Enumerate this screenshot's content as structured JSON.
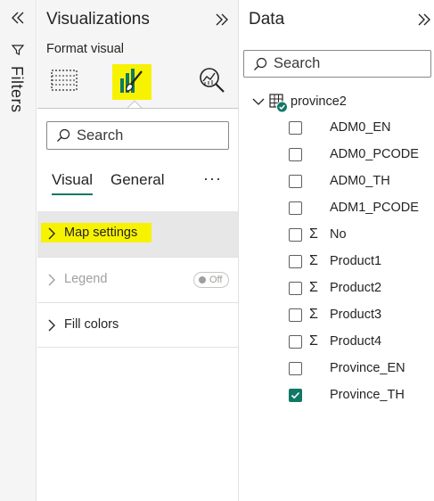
{
  "filters": {
    "label": "Filters",
    "collapse_icon": "double-chevron-left-icon",
    "funnel_icon": "funnel-icon"
  },
  "visualizations": {
    "title": "Visualizations",
    "expand_icon": "double-chevron-right-icon",
    "subtitle": "Format visual",
    "icons": [
      "build-visual-icon",
      "format-visual-icon",
      "analytics-icon"
    ],
    "highlight_color": "#f7f200",
    "search": {
      "placeholder": "Search"
    },
    "tabs": [
      {
        "label": "Visual",
        "active": true
      },
      {
        "label": "General",
        "active": false
      }
    ],
    "more_label": "···",
    "sections": [
      {
        "label": "Map settings",
        "expanded": false,
        "selected": true
      },
      {
        "label": "Legend",
        "disabled": true,
        "toggle_label": "Off"
      },
      {
        "label": "Fill colors",
        "expanded": false
      }
    ]
  },
  "data": {
    "title": "Data",
    "expand_icon": "double-chevron-right-icon",
    "search": {
      "placeholder": "Search"
    },
    "table": {
      "name": "province2",
      "fields": [
        {
          "name": "ADM0_EN",
          "sigma": "",
          "checked": false
        },
        {
          "name": "ADM0_PCODE",
          "sigma": "",
          "checked": false
        },
        {
          "name": "ADM0_TH",
          "sigma": "",
          "checked": false
        },
        {
          "name": "ADM1_PCODE",
          "sigma": "",
          "checked": false
        },
        {
          "name": "No",
          "sigma": "Σ",
          "checked": false
        },
        {
          "name": "Product1",
          "sigma": "Σ",
          "checked": false
        },
        {
          "name": "Product2",
          "sigma": "Σ",
          "checked": false
        },
        {
          "name": "Product3",
          "sigma": "Σ",
          "checked": false
        },
        {
          "name": "Product4",
          "sigma": "Σ",
          "checked": false
        },
        {
          "name": "Province_EN",
          "sigma": "",
          "checked": false
        },
        {
          "name": "Province_TH",
          "sigma": "",
          "checked": true
        }
      ]
    }
  },
  "colors": {
    "accent": "#117865",
    "pane_bg": "#f5f5f5",
    "text": "#252423"
  }
}
